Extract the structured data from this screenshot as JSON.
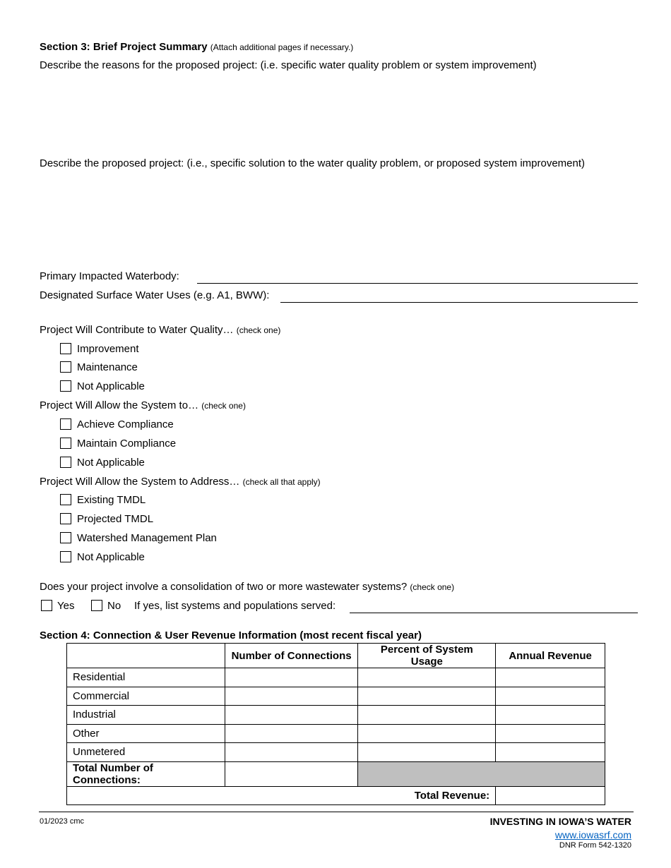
{
  "section3": {
    "title": "Section 3: Brief Project Summary",
    "title_note": "(Attach additional pages if necessary.)",
    "reasons_prompt": "Describe the reasons for the proposed project: (i.e. specific water quality problem or system improvement)",
    "project_prompt": "Describe the proposed project: (i.e., specific solution to the water quality problem, or proposed system improvement)",
    "waterbody_label": "Primary Impacted Waterbody:",
    "waterbody_value": "",
    "uses_label": "Designated Surface Water Uses (e.g. A1, BWW):",
    "uses_value": "",
    "quality_group": {
      "label": "Project Will Contribute to Water Quality…",
      "note": "(check one)",
      "options": [
        "Improvement",
        "Maintenance",
        "Not Applicable"
      ]
    },
    "compliance_group": {
      "label": "Project Will Allow the System to…",
      "note": "(check one)",
      "options": [
        "Achieve Compliance",
        "Maintain Compliance",
        "Not Applicable"
      ]
    },
    "address_group": {
      "label": "Project Will Allow the System to Address…",
      "note": "(check all that apply)",
      "options": [
        "Existing TMDL",
        "Projected TMDL",
        "Watershed Management Plan",
        "Not Applicable"
      ]
    },
    "consolidation": {
      "question": "Does your project involve a consolidation of two or more wastewater systems?",
      "note": "(check one)",
      "yes_label": "Yes",
      "no_label": "No",
      "list_label": "If yes, list systems and populations served:",
      "list_value": ""
    }
  },
  "section4": {
    "title": "Section 4: Connection & User Revenue Information (most recent fiscal year)",
    "columns": [
      "",
      "Number of Connections",
      "Percent of System Usage",
      "Annual Revenue"
    ],
    "rows": [
      "Residential",
      "Commercial",
      "Industrial",
      "Other",
      "Unmetered"
    ],
    "total_connections_label": "Total Number of Connections:",
    "total_revenue_label": "Total Revenue:"
  },
  "footer": {
    "revision": "01/2023 cmc",
    "tagline": "INVESTING IN IOWA’S WATER",
    "website": "www.iowasrf.com",
    "form_number": "DNR Form 542-1320"
  }
}
